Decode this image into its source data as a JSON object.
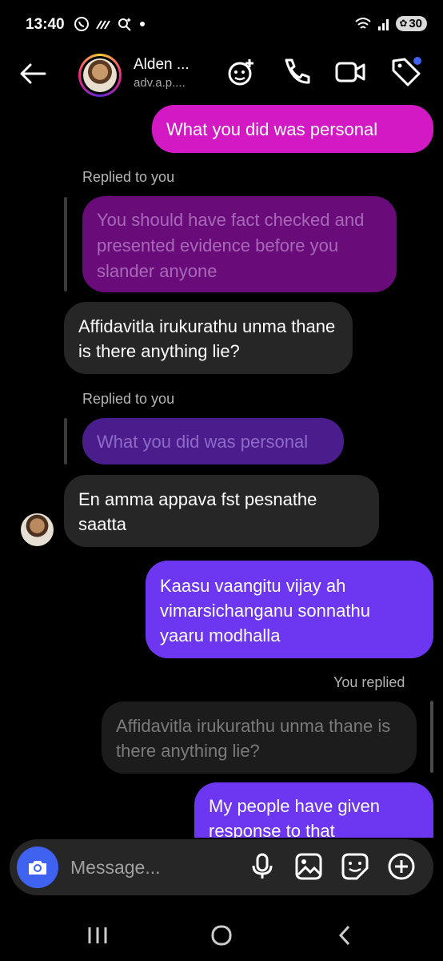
{
  "status_bar": {
    "time": "13:40",
    "left_icons": [
      "whatsapp-icon",
      "signal-icon",
      "search-sparkle-icon",
      "dot-icon"
    ],
    "battery": "30"
  },
  "header": {
    "name": "Alden ...",
    "username": "adv.a.p....",
    "icons": [
      "effects-icon",
      "phone-icon",
      "video-icon",
      "tag-icon"
    ]
  },
  "messages": [
    {
      "id": "m1",
      "type": "outgoing",
      "text": "What you did was personal"
    },
    {
      "id": "m2",
      "type": "incoming",
      "reply_label": "Replied to you",
      "quoted": "You should have fact checked and presented evidence before you slander anyone",
      "text": "Affidavitla irukurathu unma thane is there anything lie?"
    },
    {
      "id": "m3",
      "type": "incoming",
      "reply_label": "Replied to you",
      "quoted": "What you did was personal",
      "text": "En amma appava fst pesnathe saatta"
    },
    {
      "id": "m4",
      "type": "outgoing",
      "text": "Kaasu vaangitu vijay ah vimarsichanganu sonnathu yaaru modhalla"
    },
    {
      "id": "m5",
      "type": "outgoing",
      "reply_label": "You replied",
      "quoted": "Affidavitla irukurathu unma thane is there anything lie?",
      "text": "My people have given response to that"
    }
  ],
  "composer": {
    "placeholder": "Message...",
    "icons": [
      "camera-icon",
      "microphone-icon",
      "gallery-icon",
      "sticker-icon",
      "add-icon"
    ]
  },
  "colors": {
    "pink_bubble": "#d319c4",
    "purple_bubble": "#6d36f0",
    "grey_bubble": "#262626",
    "camera_button": "#3f62f0"
  }
}
